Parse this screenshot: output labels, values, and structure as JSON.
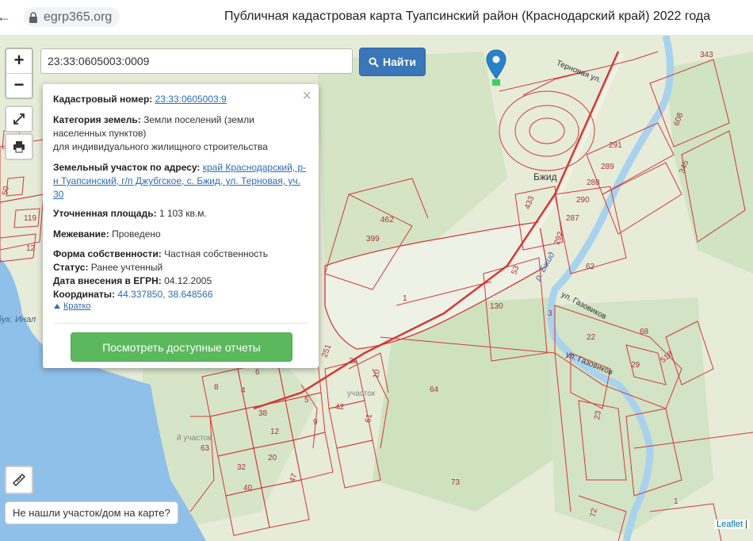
{
  "browser": {
    "url": "egrp365.org",
    "title": "Публичная кадастровая карта Туапсинский район (Краснодарский край) 2022 года"
  },
  "map_controls": {
    "zoom_in": "+",
    "zoom_out": "−"
  },
  "search": {
    "value": "23:33:0605003:0009",
    "button_label": "Найти"
  },
  "popup": {
    "cadastral_label": "Кадастровый номер:",
    "cadastral_value": "23:33:0605003:9",
    "category_label": "Категория земель:",
    "category_value": "Земли поселений (земли населенных пунктов)",
    "category_use": "для индивидуального жилищного строительства",
    "address_label": "Земельный участок по адресу:",
    "address_value": "край Краснодарский, р-н Туапсинский, г/п Джубгское, с. Бжид, ул. Терновая, уч. 30",
    "area_label": "Уточненная площадь:",
    "area_value": "1 103 кв.м.",
    "survey_label": "Межевание:",
    "survey_value": "Проведено",
    "ownership_label": "Форма собственности:",
    "ownership_value": "Частная собственность",
    "status_label": "Статус:",
    "status_value": "Ранее учтенный",
    "date_label": "Дата внесения в ЕГРН:",
    "date_value": "04.12.2005",
    "coords_label": "Координаты:",
    "coords_value": "44.337850, 38.648566",
    "toggle_label": "Кратко",
    "report_button": "Посмотреть доступные отчеты"
  },
  "map_labels": {
    "town": "Бжид",
    "bay": "бух. Инал",
    "river": "р. Бжид",
    "street1": "ул. Газовиков",
    "street2": "ул. Газовиков",
    "street3": "Терновая ул.",
    "parcel_label1": "й участок",
    "parcel_label2": "участок",
    "parcels": [
      "343",
      "608",
      "291",
      "289",
      "345",
      "288",
      "290",
      "287",
      "433",
      "292",
      "462",
      "399",
      "62",
      "53",
      "1",
      "130",
      "3",
      "68",
      "22",
      "29",
      "518",
      "251",
      "26",
      "64",
      "10",
      "6",
      "8",
      "4",
      "5",
      "9",
      "38",
      "42",
      "61",
      "12",
      "63",
      "20",
      "32",
      "47",
      "40",
      "73",
      "23",
      "72",
      "1",
      "119",
      "12",
      "50"
    ]
  },
  "not_found": "Не нашли участок/дом на карте?",
  "attribution": "Leaflet",
  "colors": {
    "parcel_outline": "#d23a3a",
    "land": "#e6ecd8",
    "forest": "#cfe2c0",
    "water": "#8fc0ea",
    "river": "#a9d2ef",
    "button_blue": "#3a76b8",
    "button_green": "#5cb85c",
    "marker": "#2a81cb"
  }
}
